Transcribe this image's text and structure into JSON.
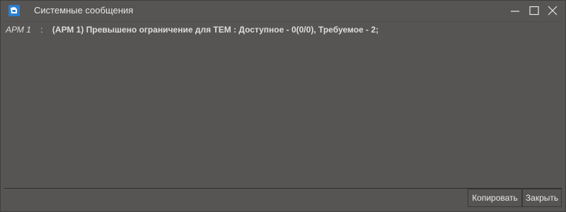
{
  "window": {
    "title": "Системные сообщения",
    "icon": "app-icon",
    "controls": {
      "minimize": "minimize-icon",
      "maximize": "maximize-icon",
      "close": "close-icon"
    }
  },
  "messages": [
    {
      "source": "АРМ 1",
      "separator": ":",
      "text": "(АРМ 1) Превышено ограничение для ТЕМ : Доступное - 0(0/0), Требуемое - 2;"
    }
  ],
  "buttons": {
    "copy_label": "Копировать",
    "close_label": "Закрыть"
  },
  "colors": {
    "background": "#565553",
    "text": "#dcdcdc",
    "icon_accent": "#2b7fd1"
  }
}
